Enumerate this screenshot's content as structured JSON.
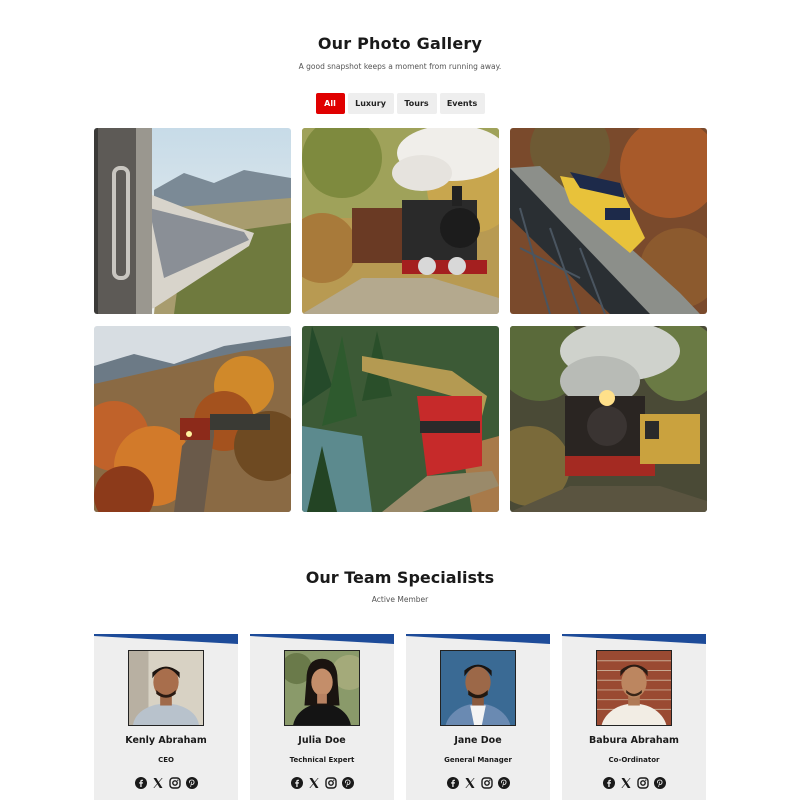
{
  "gallery": {
    "title": "Our Photo Gallery",
    "subtitle": "A good snapshot keeps a moment from running away.",
    "filters": [
      {
        "label": "All",
        "active": true
      },
      {
        "label": "Luxury",
        "active": false
      },
      {
        "label": "Tours",
        "active": false
      },
      {
        "label": "Events",
        "active": false
      }
    ],
    "photos": [
      {
        "subject": "passenger-train-window-view"
      },
      {
        "subject": "steam-locomotive-forest"
      },
      {
        "subject": "diesel-locomotive-trestle-bridge"
      },
      {
        "subject": "train-autumn-mountains"
      },
      {
        "subject": "freight-train-river-forest"
      },
      {
        "subject": "steam-train-woods-smoke"
      }
    ]
  },
  "team": {
    "title": "Our Team Specialists",
    "subtitle": "Active Member",
    "members": [
      {
        "name": "Kenly Abraham",
        "role": "CEO",
        "socials": [
          "facebook-icon",
          "x-icon",
          "instagram-icon",
          "pinterest-icon"
        ]
      },
      {
        "name": "Julia Doe",
        "role": "Technical Expert",
        "socials": [
          "facebook-icon",
          "x-icon",
          "instagram-icon",
          "pinterest-icon"
        ]
      },
      {
        "name": "Jane Doe",
        "role": "General Manager",
        "socials": [
          "facebook-icon",
          "x-icon",
          "instagram-icon",
          "pinterest-icon"
        ]
      },
      {
        "name": "Babura Abraham",
        "role": "Co-Ordinator",
        "socials": [
          "facebook-icon",
          "x-icon",
          "instagram-icon",
          "pinterest-icon"
        ]
      }
    ]
  },
  "colors": {
    "accent_red": "#e00000",
    "card_stripe_blue": "#1d4b99",
    "card_background": "#eeeeee"
  }
}
